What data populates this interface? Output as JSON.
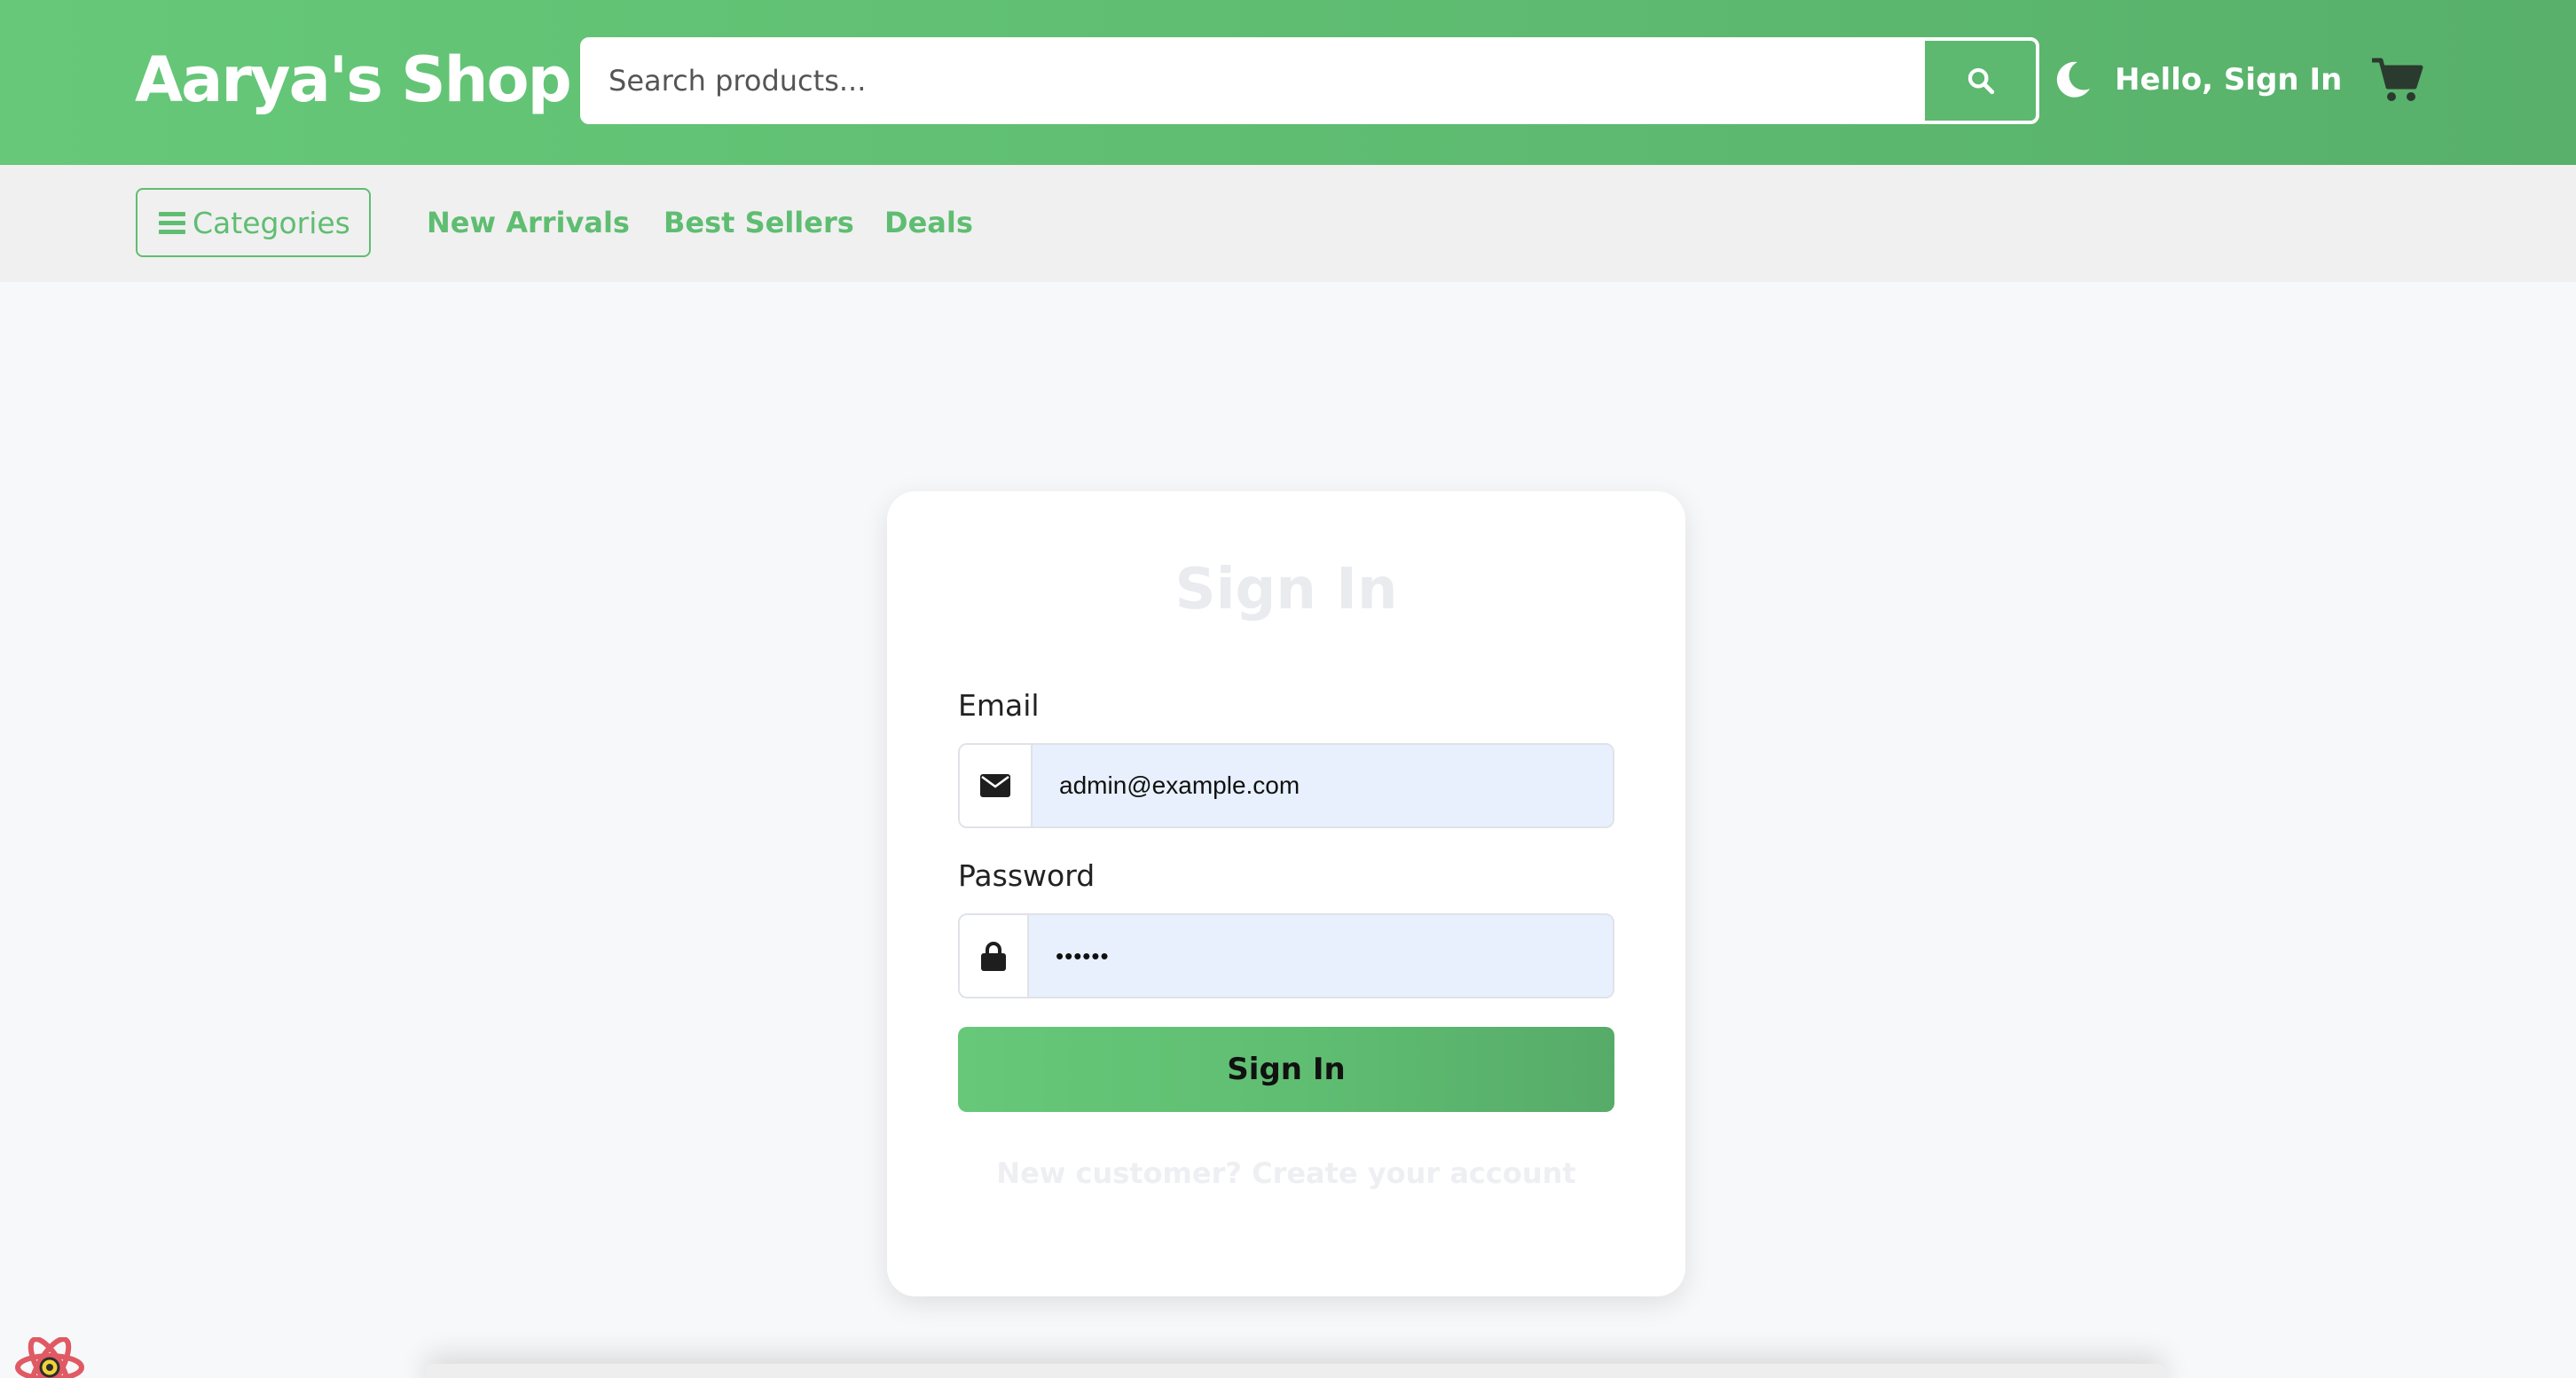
{
  "header": {
    "logo": "Aarya's Shop",
    "search_placeholder": "Search products...",
    "greeting": "Hello, Sign In",
    "icons": {
      "search": "search-icon",
      "theme": "moon-icon",
      "cart": "cart-icon"
    }
  },
  "subnav": {
    "categories_label": "Categories",
    "links": [
      "New Arrivals",
      "Best Sellers",
      "Deals"
    ]
  },
  "signin": {
    "title": "Sign In",
    "email_label": "Email",
    "email_value": "admin@example.com",
    "password_label": "Password",
    "password_value": "••••••",
    "submit_label": "Sign In",
    "register_text": "New customer? Create your account"
  },
  "colors": {
    "brand_green": "#5fbd72",
    "input_autofill": "#e8f0fe"
  }
}
